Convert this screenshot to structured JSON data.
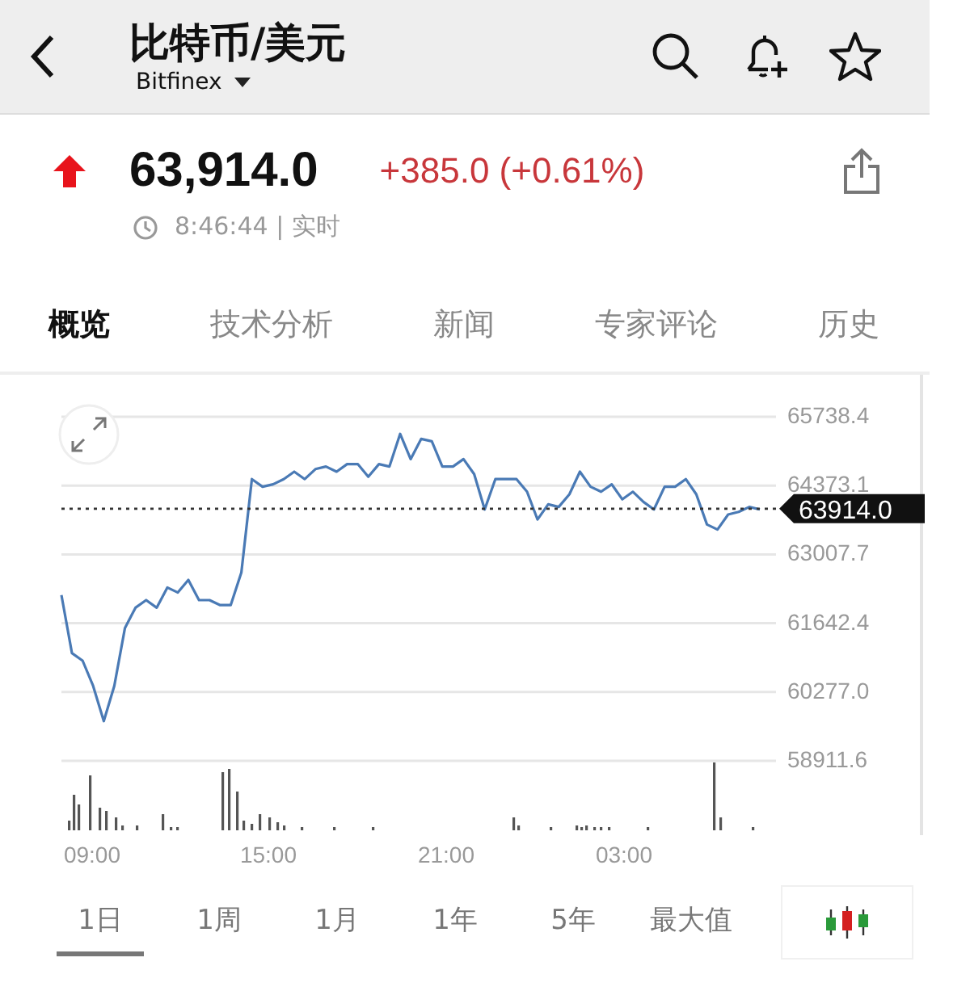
{
  "header": {
    "title": "比特币/美元",
    "exchange": "Bitfinex"
  },
  "quote": {
    "price": "63,914.0",
    "change": "+385.0 (+0.61%)",
    "up": true,
    "time": "8:46:44 | 实时"
  },
  "tabs": [
    {
      "label": "概览",
      "selected": true
    },
    {
      "label": "技术分析",
      "selected": false
    },
    {
      "label": "新闻",
      "selected": false
    },
    {
      "label": "专家评论",
      "selected": false
    },
    {
      "label": "历史",
      "selected": false
    }
  ],
  "chart": {
    "chart_data": {
      "type": "line",
      "grid": true,
      "ylim": [
        58911.6,
        65738.4
      ],
      "yticks": [
        {
          "value": 65738.4,
          "label": "65738.4"
        },
        {
          "value": 64373.1,
          "label": "64373.1"
        },
        {
          "value": 63007.7,
          "label": "63007.7"
        },
        {
          "value": 61642.4,
          "label": "61642.4"
        },
        {
          "value": 60277,
          "label": "60277.0"
        },
        {
          "value": 58911.6,
          "label": "58911.6"
        }
      ],
      "series": [
        {
          "color": "#4a7ab5",
          "values": [
            62200,
            61050,
            60900,
            60400,
            59700,
            60400,
            61550,
            61950,
            62100,
            61950,
            62350,
            62250,
            62500,
            62100,
            62100,
            62000,
            62000,
            62650,
            64500,
            64350,
            64400,
            64500,
            64650,
            64500,
            64700,
            64750,
            64650,
            64800,
            64800,
            64550,
            64800,
            64750,
            65400,
            64900,
            65300,
            65250,
            64750,
            64750,
            64900,
            64600,
            63900,
            64500,
            64500,
            64500,
            64250,
            63700,
            64000,
            63950,
            64200,
            64650,
            64350,
            64250,
            64400,
            64100,
            64250,
            64050,
            63900,
            64350,
            64350,
            64500,
            64200,
            63600,
            63500,
            63800,
            63850,
            63950,
            63900
          ]
        }
      ],
      "ref_lines": [
        {
          "axis": "y",
          "value": 63914,
          "label": "63914.0"
        }
      ]
    },
    "x_labels": [
      "09:00",
      "15:00",
      "21:00",
      "03:00"
    ]
  },
  "ranges": [
    {
      "label": "1日",
      "selected": true
    },
    {
      "label": "1周",
      "selected": false
    },
    {
      "label": "1月",
      "selected": false
    },
    {
      "label": "1年",
      "selected": false
    },
    {
      "label": "5年",
      "selected": false
    },
    {
      "label": "最大值",
      "selected": false
    }
  ]
}
